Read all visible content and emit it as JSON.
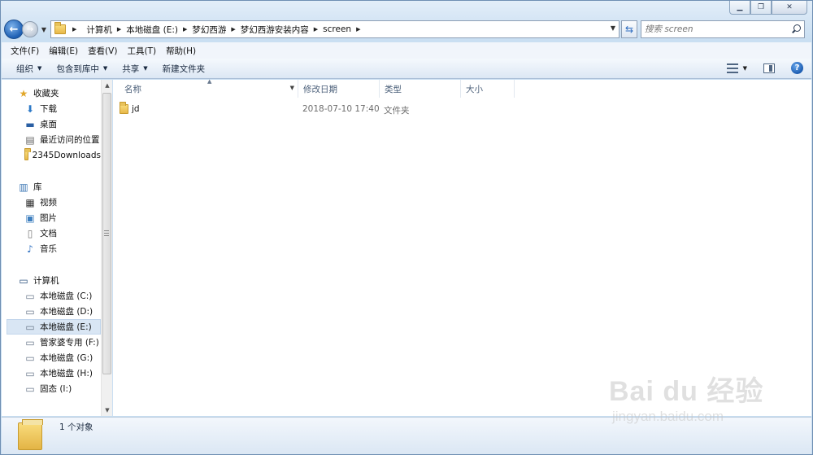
{
  "window": {
    "caption_buttons": [
      "minimize",
      "maximize",
      "close"
    ]
  },
  "address_bar": {
    "breadcrumbs": [
      "计算机",
      "本地磁盘 (E:)",
      "梦幻西游",
      "梦幻西游安装内容",
      "screen"
    ]
  },
  "search": {
    "placeholder": "搜索 screen"
  },
  "menu": [
    "文件(F)",
    "编辑(E)",
    "查看(V)",
    "工具(T)",
    "帮助(H)"
  ],
  "commands": [
    {
      "label": "组织",
      "dropdown": true
    },
    {
      "label": "包含到库中",
      "dropdown": true
    },
    {
      "label": "共享",
      "dropdown": true
    },
    {
      "label": "新建文件夹",
      "dropdown": false
    }
  ],
  "nav": {
    "favorites_header": "收藏夹",
    "favorites": [
      "下载",
      "桌面",
      "最近访问的位置",
      "2345Downloads"
    ],
    "libraries_header": "库",
    "libraries": [
      "视频",
      "图片",
      "文档",
      "音乐"
    ],
    "computer_header": "计算机",
    "drives": [
      "本地磁盘 (C:)",
      "本地磁盘 (D:)",
      "本地磁盘 (E:)",
      "管家婆专用 (F:)",
      "本地磁盘 (G:)",
      "本地磁盘 (H:)",
      "固态 (I:)"
    ],
    "selected_drive": "本地磁盘 (E:)"
  },
  "columns": [
    "名称",
    "修改日期",
    "类型",
    "大小"
  ],
  "files": [
    {
      "name": "jd",
      "modified": "2018-07-10 17:40",
      "type": "文件夹",
      "size": ""
    }
  ],
  "status": {
    "count_text": "1 个对象"
  },
  "watermark": {
    "logo": "Bai du 经验",
    "url": "jingyan.baidu.com"
  },
  "colors": {
    "window_bg": "#d6e6f5",
    "selected_bg": "#d9e6f4",
    "folder_yellow": "#f9dc7c"
  }
}
